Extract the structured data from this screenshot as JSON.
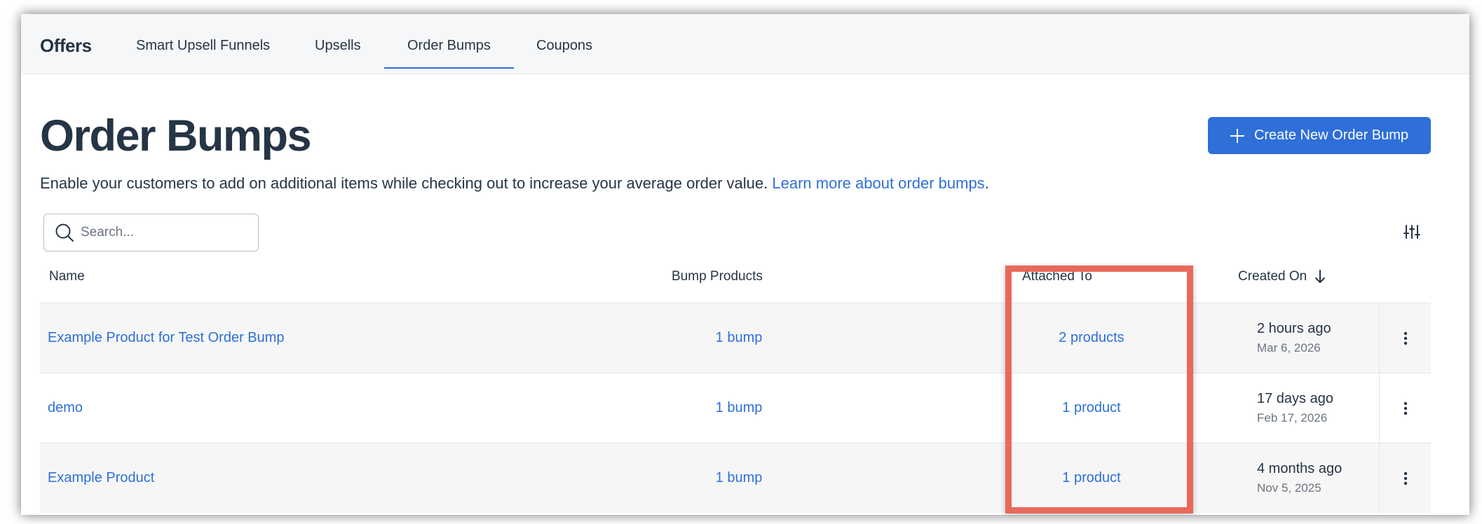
{
  "nav": {
    "brand": "Offers",
    "tabs": [
      {
        "label": "Smart Upsell Funnels",
        "active": false
      },
      {
        "label": "Upsells",
        "active": false
      },
      {
        "label": "Order Bumps",
        "active": true
      },
      {
        "label": "Coupons",
        "active": false
      }
    ]
  },
  "header": {
    "title": "Order Bumps",
    "create_button": "Create New Order Bump",
    "create_icon": "plus-icon",
    "description": "Enable your customers to add on additional items while checking out to increase your average order value.",
    "learn_more": "Learn more about order bumps",
    "period": "."
  },
  "search": {
    "placeholder": "Search...",
    "icon": "search-icon"
  },
  "toolbar": {
    "filter_icon": "sliders-icon"
  },
  "table": {
    "columns": {
      "name": "Name",
      "bump_products": "Bump Products",
      "attached_to": "Attached To",
      "created_on": "Created On",
      "sort_icon": "arrow-down-icon"
    },
    "rows": [
      {
        "name": "Example Product for Test Order Bump",
        "bumps": "1 bump",
        "attached": "2 products",
        "created_relative": "2 hours ago",
        "created_date": "Mar 6, 2026"
      },
      {
        "name": "demo",
        "bumps": "1 bump",
        "attached": "1 product",
        "created_relative": "17 days ago",
        "created_date": "Feb 17, 2026"
      },
      {
        "name": "Example Product",
        "bumps": "1 bump",
        "attached": "1 product",
        "created_relative": "4 months ago",
        "created_date": "Nov 5, 2025"
      }
    ],
    "row_menu_icon": "kebab-menu-icon"
  },
  "colors": {
    "accent": "#2e6fd8",
    "highlight": "#e8695a",
    "text": "#263545"
  }
}
